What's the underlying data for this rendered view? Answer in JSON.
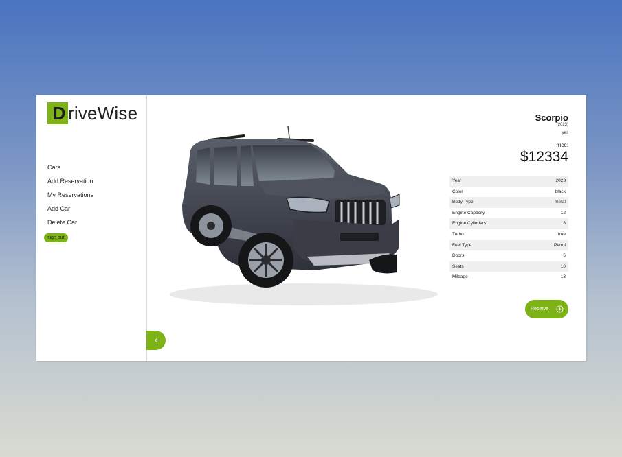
{
  "brand": {
    "logo_letter": "D",
    "logo_rest": "riveWise",
    "accent_color": "#7db317"
  },
  "nav": {
    "items": [
      "Cars",
      "Add Reservation",
      "My Reservations",
      "Add Car",
      "Delete Car"
    ],
    "signout_label": "sign out"
  },
  "car": {
    "name": "Scorpio",
    "year": "(2023)",
    "available": "yes",
    "price_label": "Price:",
    "price": "$12334",
    "specs": [
      {
        "label": "Year",
        "value": "2023"
      },
      {
        "label": "Color",
        "value": "black"
      },
      {
        "label": "Body Type",
        "value": "metal"
      },
      {
        "label": "Engine Capacity",
        "value": "12"
      },
      {
        "label": "Engine Cylinders",
        "value": "8"
      },
      {
        "label": "Turbo",
        "value": "true"
      },
      {
        "label": "Fuel Type",
        "value": "Petrol"
      },
      {
        "label": "Doors",
        "value": "5"
      },
      {
        "label": "Seats",
        "value": "10"
      },
      {
        "label": "Mileage",
        "value": "13"
      }
    ],
    "reserve_label": "Reserve"
  },
  "icons": {
    "back": "caret-left-icon",
    "reserve": "circle-chevron-right-icon"
  }
}
